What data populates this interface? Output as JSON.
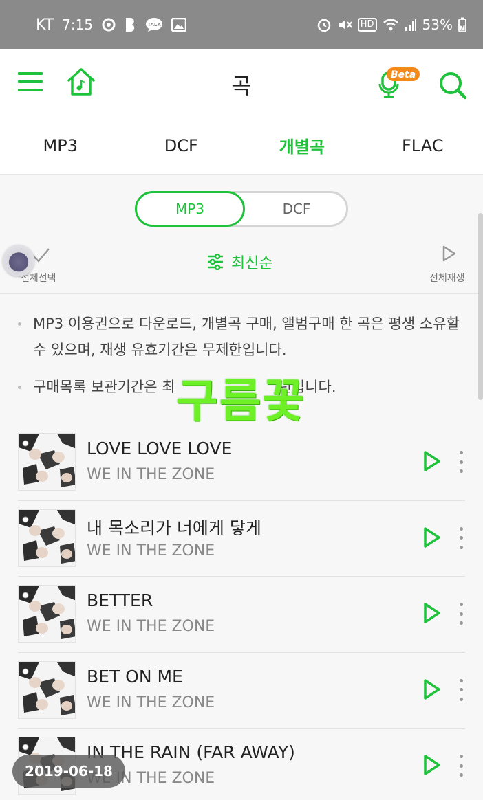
{
  "status_bar": {
    "carrier": "KT",
    "time": "7:15",
    "hd_label": "HD",
    "battery": "53%"
  },
  "header": {
    "title": "곡",
    "beta_badge": "Beta"
  },
  "tabs": [
    {
      "label": "MP3",
      "active": false
    },
    {
      "label": "DCF",
      "active": false
    },
    {
      "label": "개별곡",
      "active": true
    },
    {
      "label": "FLAC",
      "active": false
    }
  ],
  "segment": {
    "options": [
      "MP3",
      "DCF"
    ],
    "selected": "MP3"
  },
  "toolbar": {
    "select_all_label": "전체선택",
    "sort_label": "최신순",
    "play_all_label": "전체재생"
  },
  "notices": [
    "MP3 이용권으로 다운로드, 개별곡 구매, 앨범구매 한 곡은 평생 소유할 수 있으며, 재생 유효기간은 무제한입니다.",
    "구매목록 보관기간은 최초 [가려짐] 년입니다."
  ],
  "notice_2_parts": {
    "before": "구매목록 보관기간은 최",
    "after": "년입니다."
  },
  "watermark": "구름꽃",
  "songs": [
    {
      "title": "LOVE LOVE LOVE",
      "artist": "WE IN THE ZONE"
    },
    {
      "title": "내 목소리가 너에게 닿게",
      "artist": "WE IN THE ZONE"
    },
    {
      "title": "BETTER",
      "artist": "WE IN THE ZONE"
    },
    {
      "title": "BET ON ME",
      "artist": "WE IN THE ZONE"
    },
    {
      "title": "IN THE RAIN (FAR AWAY)",
      "artist": "WE IN THE ZONE"
    }
  ],
  "date_stamp": "2019-06-18",
  "colors": {
    "accent": "#1fc33b",
    "beta_badge": "#f48a1a",
    "status_bar": "#8a8a8a"
  }
}
